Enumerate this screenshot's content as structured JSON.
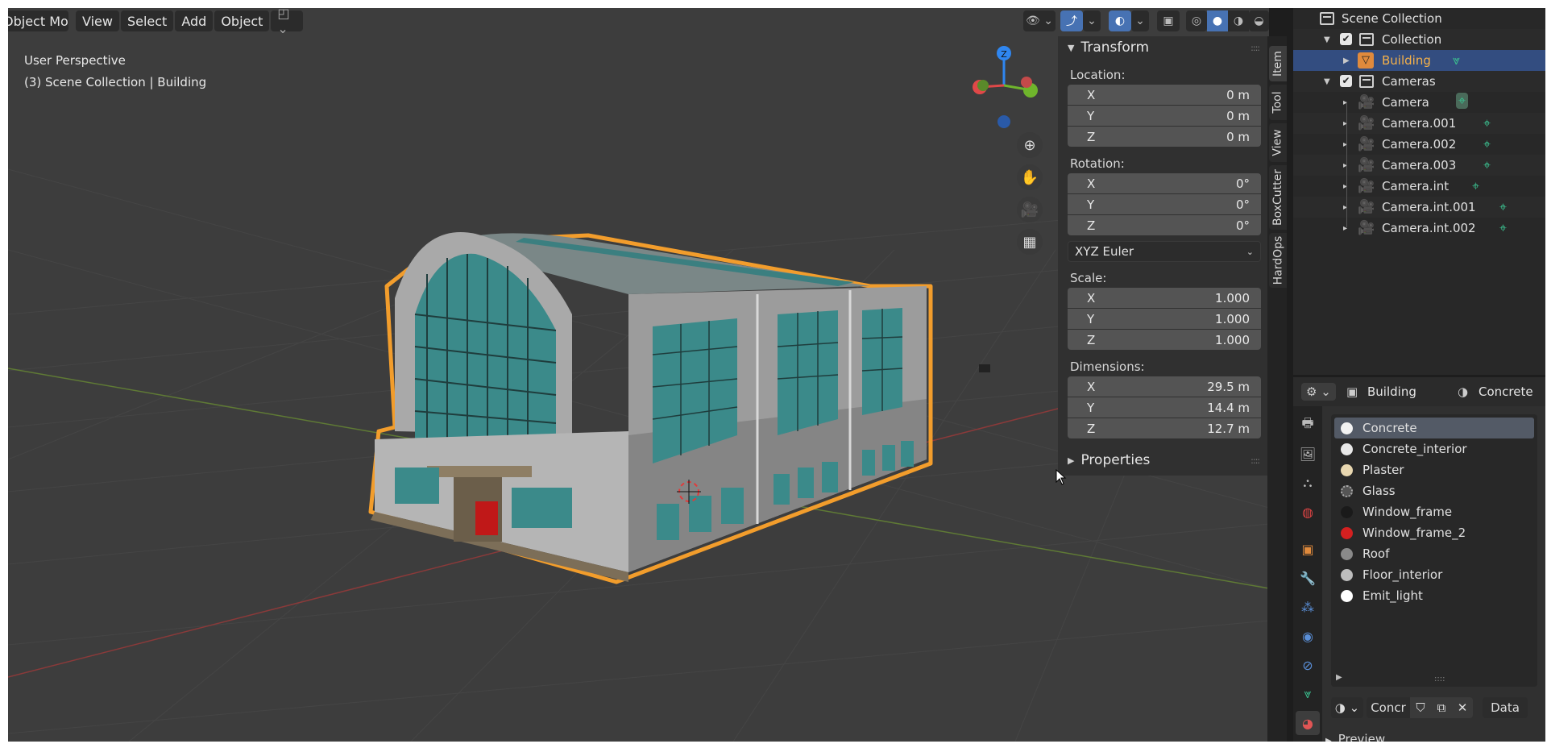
{
  "header": {
    "mode_label": "Object Mode",
    "menus": [
      "View",
      "Select",
      "Add",
      "Object"
    ]
  },
  "viewport": {
    "perspective_label": "User Perspective",
    "context_label": "(3) Scene Collection | Building"
  },
  "npanel": {
    "tabs": [
      "Item",
      "Tool",
      "View",
      "BoxCutter",
      "HardOps"
    ],
    "transform_title": "Transform",
    "location_label": "Location:",
    "location": [
      {
        "axis": "X",
        "value": "0 m"
      },
      {
        "axis": "Y",
        "value": "0 m"
      },
      {
        "axis": "Z",
        "value": "0 m"
      }
    ],
    "rotation_label": "Rotation:",
    "rotation": [
      {
        "axis": "X",
        "value": "0°"
      },
      {
        "axis": "Y",
        "value": "0°"
      },
      {
        "axis": "Z",
        "value": "0°"
      }
    ],
    "rotation_mode": "XYZ Euler",
    "scale_label": "Scale:",
    "scale": [
      {
        "axis": "X",
        "value": "1.000"
      },
      {
        "axis": "Y",
        "value": "1.000"
      },
      {
        "axis": "Z",
        "value": "1.000"
      }
    ],
    "dimensions_label": "Dimensions:",
    "dimensions": [
      {
        "axis": "X",
        "value": "29.5 m"
      },
      {
        "axis": "Y",
        "value": "14.4 m"
      },
      {
        "axis": "Z",
        "value": "12.7 m"
      }
    ],
    "properties_title": "Properties"
  },
  "outliner": {
    "root": "Scene Collection",
    "collection": "Collection",
    "building": "Building",
    "cameras_collection": "Cameras",
    "cameras": [
      "Camera",
      "Camera.001",
      "Camera.002",
      "Camera.003",
      "Camera.int",
      "Camera.int.001",
      "Camera.int.002"
    ]
  },
  "properties": {
    "object_name": "Building",
    "material_name": "Concrete",
    "materials": [
      {
        "name": "Concrete",
        "color": "#f2f2f2"
      },
      {
        "name": "Concrete_interior",
        "color": "#e8e8e8"
      },
      {
        "name": "Plaster",
        "color": "#e8d7b0"
      },
      {
        "name": "Glass",
        "color": "#9a9a9a"
      },
      {
        "name": "Window_frame",
        "color": "#1a1a1a"
      },
      {
        "name": "Window_frame_2",
        "color": "#d42020"
      },
      {
        "name": "Roof",
        "color": "#8a8a8a"
      },
      {
        "name": "Floor_interior",
        "color": "#bdbdbd"
      },
      {
        "name": "Emit_light",
        "color": "#ffffff"
      }
    ],
    "slot_name": "Concr",
    "data_label": "Data",
    "preview_label": "Preview"
  },
  "colors": {
    "accent_blue": "#4772b3",
    "selection_orange": "#f29d2c",
    "outliner_selected": "#334d80"
  }
}
